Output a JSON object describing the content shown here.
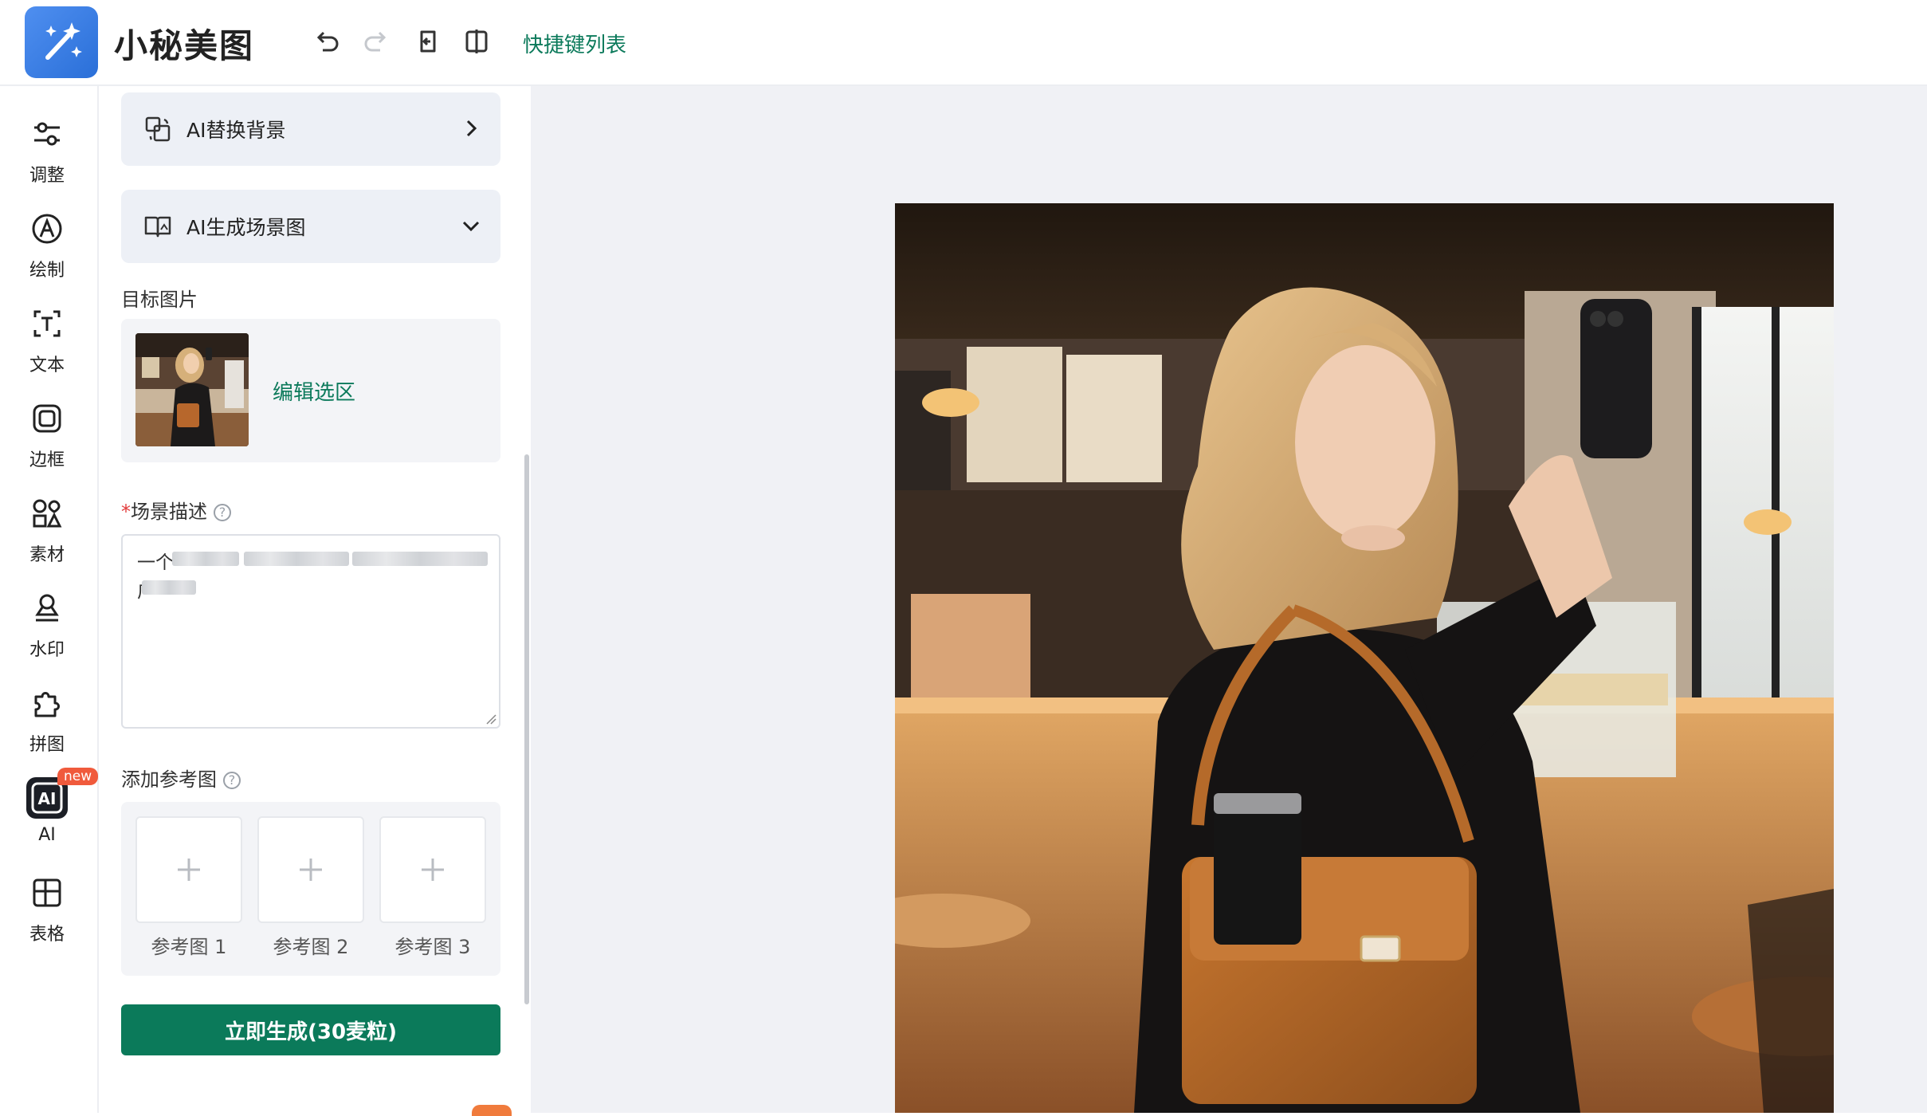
{
  "header": {
    "app_title": "小秘美图",
    "shortcut_link": "快捷键列表",
    "icons": [
      "magic-wand-icon",
      "undo-icon",
      "redo-icon",
      "restore-icon",
      "compare-icon"
    ]
  },
  "rail": {
    "items": [
      {
        "label": "调整",
        "icon": "sliders-icon"
      },
      {
        "label": "绘制",
        "icon": "brush-icon"
      },
      {
        "label": "文本",
        "icon": "text-icon"
      },
      {
        "label": "边框",
        "icon": "frame-icon"
      },
      {
        "label": "素材",
        "icon": "shapes-icon"
      },
      {
        "label": "水印",
        "icon": "stamp-icon"
      },
      {
        "label": "拼图",
        "icon": "puzzle-icon"
      },
      {
        "label": "AI",
        "icon": "ai-icon",
        "badge": "new",
        "active": true
      },
      {
        "label": "表格",
        "icon": "table-icon"
      }
    ]
  },
  "panel": {
    "ai_replace_bg": "AI替换背景",
    "ai_generate_scene": "AI生成场景图",
    "target_image_label": "目标图片",
    "edit_selection": "编辑选区",
    "required_mark": "*",
    "scene_desc_label": "场景描述",
    "scene_desc_visible_start": "一个",
    "scene_desc_line2_start": "广",
    "add_ref_label": "添加参考图",
    "refs": [
      "参考图 1",
      "参考图 2",
      "参考图 3"
    ],
    "generate_button": "立即生成(30麦粒)",
    "help_glyph": "?"
  },
  "colors": {
    "accent": "#0b7a5a",
    "link": "#0c7a5b",
    "logo": "#3a7fe6",
    "badge": "#f05a3c",
    "canvas_bg": "#f0f1f5"
  }
}
